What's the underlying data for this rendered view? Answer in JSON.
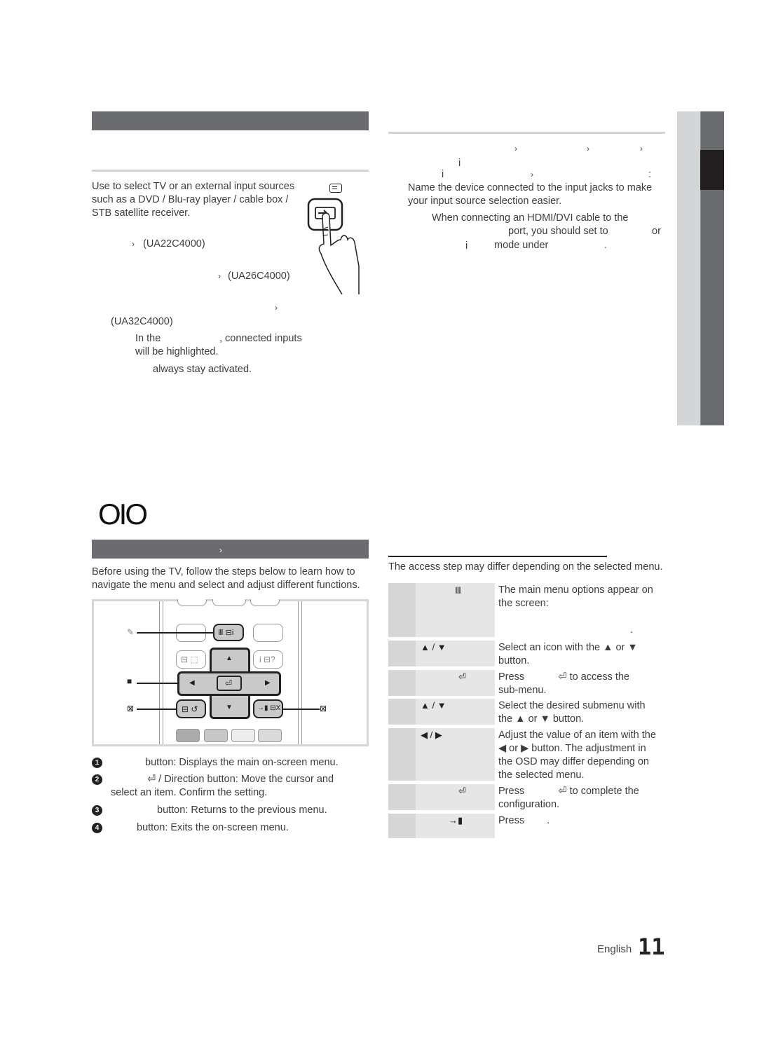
{
  "left_top_section": {
    "description": [
      "Use to select TV or an external input sources",
      "such as a DVD / Blu-ray player / cable box /",
      "STB satellite receiver."
    ],
    "model_lines": [
      {
        "chevron": "›",
        "model": "(UA22C4000)"
      },
      {
        "chevron": "›",
        "model": "(UA26C4000)"
      },
      {
        "chevron": "›",
        "model": "(UA32C4000)"
      }
    ],
    "note_1_line1_a": "In the",
    "note_1_line1_b": ", connected inputs",
    "note_1_line2": "will be highlighted.",
    "note_2": "always stay activated.",
    "source_icon": "source-list-icon",
    "hand_icon": "hand-pressing-button-icon"
  },
  "right_top_section": {
    "breadcrumb_chevrons": [
      "›",
      "›",
      "›"
    ],
    "glyph_i": "i",
    "line3_chevron": "›",
    "line3_colon": ":",
    "description": [
      "Name the device connected to the input jacks to make",
      "your input source selection easier."
    ],
    "note_line1": "When connecting an HDMI/DVI cable to the",
    "note_line2_a": "port, you should set to",
    "note_line2_b": "or",
    "note_line3_i": "i",
    "note_line3": "mode under",
    "note_line3_end": "."
  },
  "chapter_mark": "OIO",
  "menu_section": {
    "header_chevron": "›",
    "intro": [
      "Before using the TV, follow the steps below to learn how to",
      "navigate the menu and select and adjust different functions."
    ],
    "remote_callout_markers": [
      "✎",
      "■",
      "⊠",
      "⊠"
    ],
    "remote_labels": {
      "menu": "Ⅲ ⊟i",
      "up": "▲",
      "down": "▼",
      "left": "◀",
      "right": "▶",
      "enter": "⏎",
      "return": "⊟ ↺",
      "exit": "→▮ ⊟X",
      "tools": "⊟ ⬚",
      "info": "i ⊟?"
    },
    "remote_color_buttons": [
      "#a9abac",
      "#c6c8c8",
      "#eceded",
      "#d9dadc"
    ],
    "legend": [
      {
        "num": "1",
        "text": "button: Displays the main on-screen menu."
      },
      {
        "num": "2",
        "text_a": "⏎ / Direction button: Move the cursor and",
        "text_b": "select an item. Confirm the setting."
      },
      {
        "num": "3",
        "text": "button: Returns to the previous menu."
      },
      {
        "num": "4",
        "text": "button: Exits the on-screen menu."
      }
    ]
  },
  "steps_section": {
    "note": "The access step may differ depending on the selected menu.",
    "rows": [
      {
        "key": "Ⅲ",
        "desc": [
          "The main menu options appear on",
          "the screen:",
          "",
          "."
        ]
      },
      {
        "key": "▲ / ▼",
        "desc": [
          "Select an icon with the ▲ or ▼",
          "button."
        ]
      },
      {
        "key": "⏎",
        "desc": [
          "Press            ⏎ to access the",
          "sub-menu."
        ]
      },
      {
        "key": "▲ / ▼",
        "desc": [
          "Select the desired submenu with",
          "the ▲ or ▼ button."
        ]
      },
      {
        "key": "◀ / ▶",
        "desc": [
          "Adjust the value of an item with the",
          "◀ or ▶ button. The adjustment in",
          "the OSD may differ depending on",
          "the selected menu."
        ]
      },
      {
        "key": "⏎",
        "desc": [
          "Press            ⏎ to complete the",
          "configuration."
        ]
      },
      {
        "key": "→▮",
        "desc": [
          "Press        ."
        ]
      }
    ]
  },
  "footer": {
    "language": "English",
    "page_number": "11"
  }
}
